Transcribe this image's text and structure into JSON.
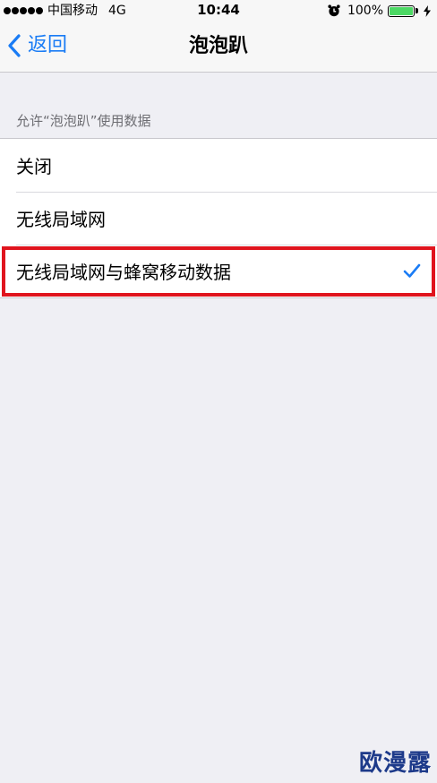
{
  "status_bar": {
    "carrier": "中国移动",
    "network": "4G",
    "time": "10:44",
    "battery": "100%",
    "battery_color": "#4cd964",
    "icons": [
      "signal-dots-icon",
      "alarm-icon",
      "battery-icon",
      "charging-bolt-icon"
    ]
  },
  "nav": {
    "back_label": "返回",
    "title": "泡泡趴",
    "accent": "#1a7cf5"
  },
  "section": {
    "header": "允许“泡泡趴”使用数据"
  },
  "options": [
    {
      "label": "关闭",
      "selected": false
    },
    {
      "label": "无线局域网",
      "selected": false
    },
    {
      "label": "无线局域网与蜂窝移动数据",
      "selected": true
    }
  ],
  "highlight_color": "#e0141e",
  "watermark": "欧漫露"
}
